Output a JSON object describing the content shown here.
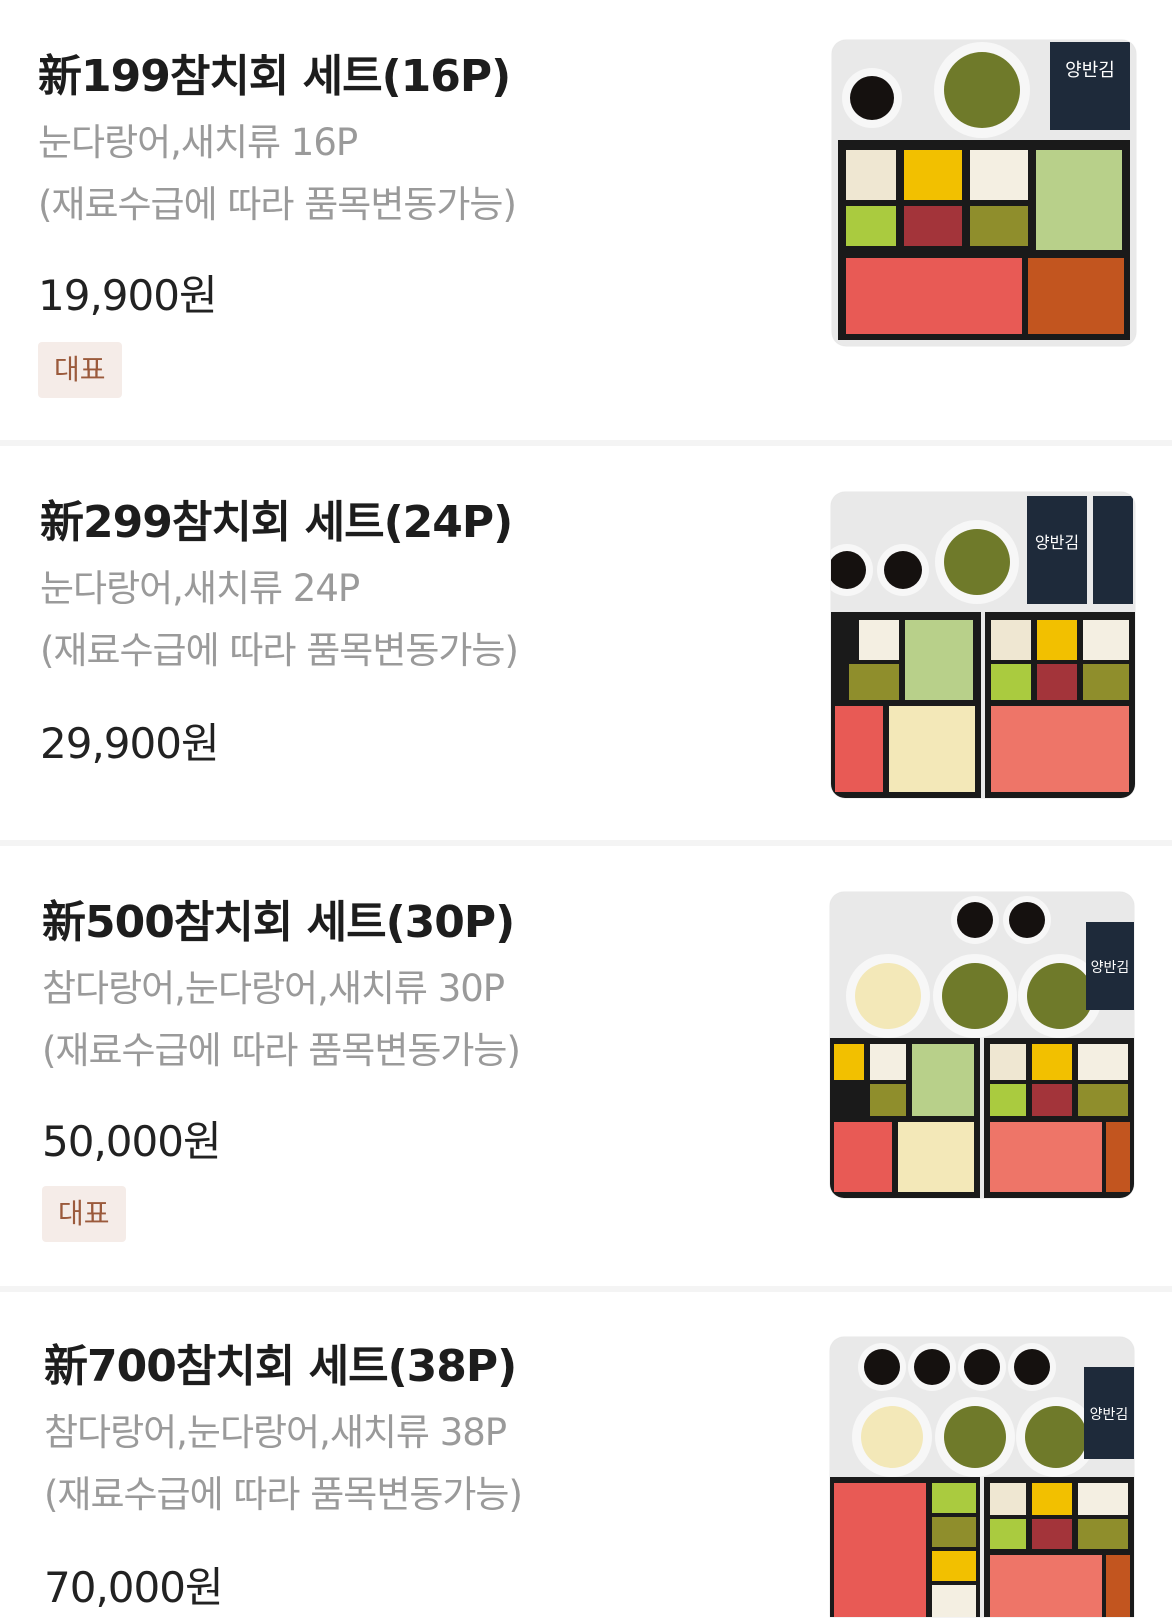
{
  "items": [
    {
      "name": "新199참치회 세트(16P)",
      "desc_line1": "눈다랑어,새치류 16P",
      "desc_line2": "(재료수급에 따라 품목변동가능)",
      "price": "19,900원",
      "badge": "대표",
      "photo_label": "참치회 세트 16P 사진",
      "kim_label": "양반김"
    },
    {
      "name": "新299참치회 세트(24P)",
      "desc_line1": "눈다랑어,새치류 24P",
      "desc_line2": "(재료수급에 따라 품목변동가능)",
      "price": "29,900원",
      "badge": "",
      "photo_label": "참치회 세트 24P 사진",
      "kim_label": "양반김"
    },
    {
      "name": "新500참치회 세트(30P)",
      "desc_line1": "참다랑어,눈다랑어,새치류 30P",
      "desc_line2": "(재료수급에 따라 품목변동가능)",
      "price": "50,000원",
      "badge": "대표",
      "photo_label": "참치회 세트 30P 사진",
      "kim_label": "양반김"
    },
    {
      "name": "新700참치회 세트(38P)",
      "desc_line1": "참다랑어,눈다랑어,새치류 38P",
      "desc_line2": "(재료수급에 따라 품목변동가능)",
      "price": "70,000원",
      "badge": "",
      "photo_label": "참치회 세트 38P 사진",
      "kim_label": "양반김"
    }
  ],
  "colors": {
    "title": "#1d1d1d",
    "desc": "#9a9a9a",
    "price": "#222222",
    "badge_bg": "#f5ece8",
    "badge_text": "#9b5a3c",
    "divider": "#f4f4f4"
  }
}
